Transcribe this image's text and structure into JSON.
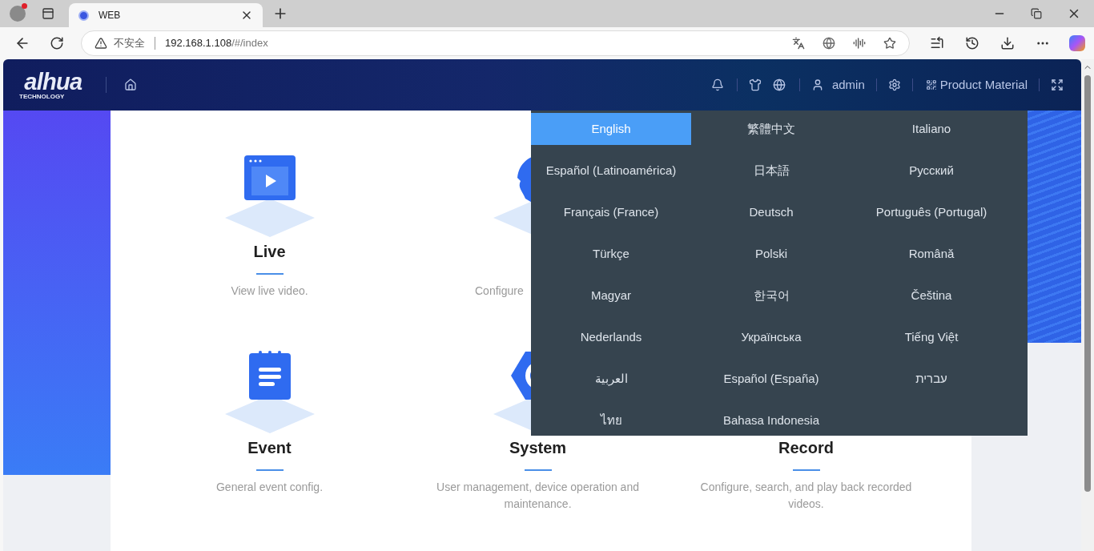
{
  "browser": {
    "tabs": [
      {
        "title": "WEB",
        "selected": true
      }
    ],
    "security_label": "不安全",
    "url_host": "192.168.1.108",
    "url_path": "/#/index"
  },
  "header": {
    "logo": {
      "wordmark": "alhua",
      "tagline": "TECHNOLOGY"
    },
    "user": "admin",
    "product_material": "Product Material"
  },
  "module_rows": [
    {
      "modules": [
        {
          "kind": "live",
          "title": "Live",
          "description": "View live video."
        },
        {
          "kind": "ai",
          "description": "Configure"
        }
      ]
    },
    {
      "modules": [
        {
          "kind": "event",
          "title": "Event",
          "description": "General event config."
        },
        {
          "kind": "system",
          "title": "System",
          "description": "User management, device operation and maintenance."
        },
        {
          "title": "Record",
          "description": "Configure, search, and play back recorded videos."
        }
      ]
    }
  ],
  "language_menu": {
    "items": [
      {
        "label": "English",
        "selected": true
      },
      {
        "label": "繁體中文",
        "selected": false
      },
      {
        "label": "Italiano",
        "selected": false
      },
      {
        "label": "Español (Latinoamérica)",
        "selected": false
      },
      {
        "label": "日本語",
        "selected": false
      },
      {
        "label": "Русский",
        "selected": false
      },
      {
        "label": "Français (France)",
        "selected": false
      },
      {
        "label": "Deutsch",
        "selected": false
      },
      {
        "label": "Português (Portugal)",
        "selected": false
      },
      {
        "label": "Türkçe",
        "selected": false
      },
      {
        "label": "Polski",
        "selected": false
      },
      {
        "label": "Română",
        "selected": false
      },
      {
        "label": "Magyar",
        "selected": false
      },
      {
        "label": "한국어",
        "selected": false
      },
      {
        "label": "Čeština",
        "selected": false
      },
      {
        "label": "Nederlands",
        "selected": false
      },
      {
        "label": "Українська",
        "selected": false
      },
      {
        "label": "Tiếng Việt",
        "selected": false
      },
      {
        "label": "العربية",
        "selected": false
      },
      {
        "label": "Español (España)",
        "selected": false
      },
      {
        "label": "עברית",
        "selected": false
      },
      {
        "label": "ไทย",
        "selected": false
      },
      {
        "label": "Bahasa Indonesia",
        "selected": false
      }
    ]
  }
}
